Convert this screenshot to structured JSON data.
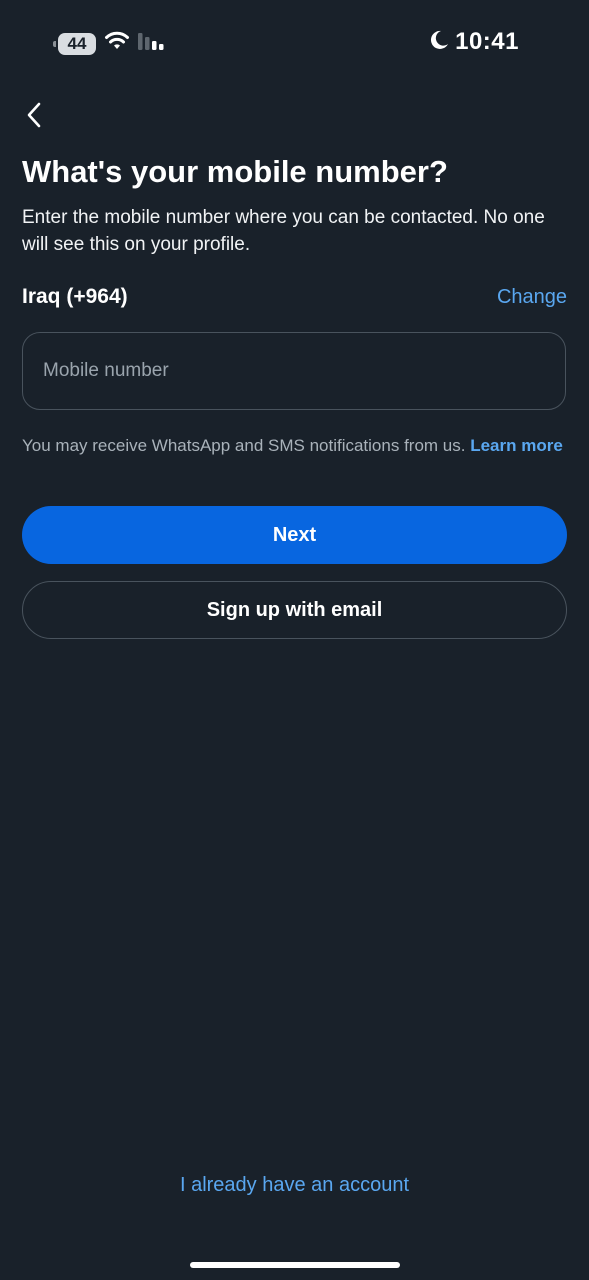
{
  "status_bar": {
    "battery_level": "44",
    "time": "10:41",
    "icons": [
      "battery-icon",
      "wifi-icon",
      "signal-icon",
      "moon-icon"
    ]
  },
  "header": {
    "back_icon": "chevron-left-icon",
    "title": "What's your mobile number?",
    "subtitle": "Enter the mobile number where you can be contacted. No one will see this on your profile."
  },
  "country": {
    "label": "Iraq (+964)",
    "change_label": "Change"
  },
  "phone_input": {
    "value": "",
    "placeholder": "Mobile number"
  },
  "notice": {
    "text": "You may receive WhatsApp and SMS notifications from us.",
    "link": "Learn more"
  },
  "actions": {
    "next_label": "Next",
    "email_label": "Sign up with email"
  },
  "footer": {
    "account_link": "I already have an account"
  },
  "colors": {
    "background": "#19212a",
    "primary": "#0866e0",
    "link": "#5aa7f0",
    "border": "#49535d"
  }
}
